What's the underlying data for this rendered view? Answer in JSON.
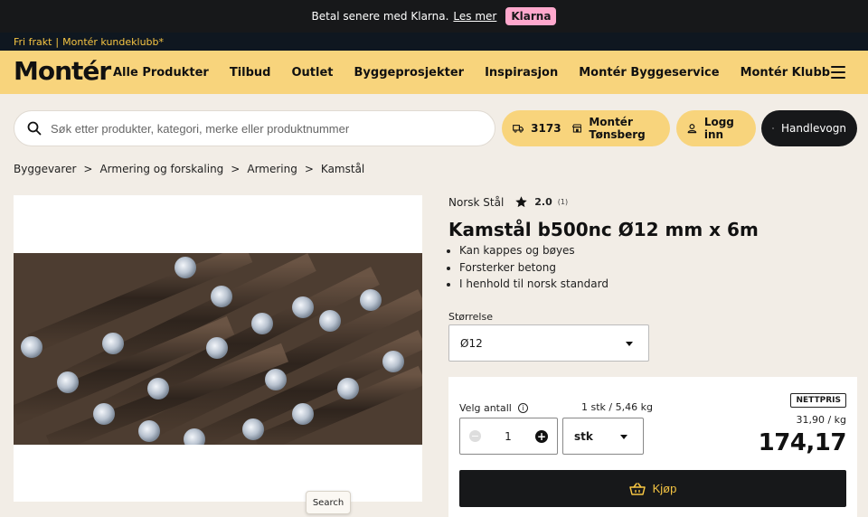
{
  "promo": {
    "text": "Betal senere med Klarna.",
    "link": "Les mer",
    "badge": "Klarna"
  },
  "subbar": {
    "left": "Fri frakt",
    "right": "Montér kundeklubb*"
  },
  "nav": {
    "logo": "Montér",
    "items": [
      "Alle Produkter",
      "Tilbud",
      "Outlet",
      "Byggeprosjekter",
      "Inspirasjon",
      "Montér Byggeservice",
      "Montér Klubb"
    ]
  },
  "search": {
    "placeholder": "Søk etter produkter, kategori, merke eller produktnummer"
  },
  "header_actions": {
    "postal_code": "3173",
    "store": "Montér Tønsberg",
    "login": "Logg inn",
    "cart": "Handlevogn"
  },
  "breadcrumb": [
    "Byggevarer",
    "Armering og forskaling",
    "Armering",
    "Kamstål"
  ],
  "product": {
    "brand": "Norsk Stål",
    "rating": "2.0",
    "rating_count": "(1)",
    "title": "Kamstål b500nc Ø12 mm x 6m",
    "features": [
      "Kan kappes og bøyes",
      "Forsterker betong",
      "I henhold til norsk standard"
    ],
    "size_label": "Størrelse",
    "size_value": "Ø12"
  },
  "purchase": {
    "qty_label": "Velg antall",
    "unit_info": "1 stk / 5,46 kg",
    "quantity": "1",
    "unit": "stk",
    "price_badge": "NETTPRIS",
    "price_per_kg": "31,90 / kg",
    "price": "174,17",
    "buy_label": "Kjøp"
  },
  "tooltip": "Search",
  "colors": {
    "accent_yellow": "#f8d47c",
    "dark": "#17181a",
    "klarna_pink": "#ffa8cd",
    "logo_red": "#e63323"
  }
}
